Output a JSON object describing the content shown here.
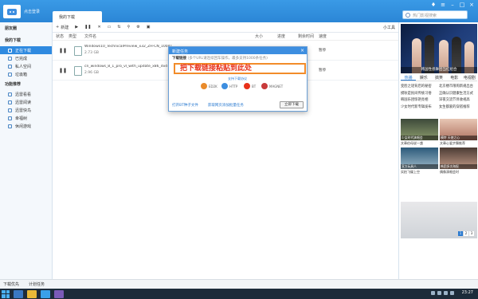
{
  "titlebar": {
    "login_label": "点击登录",
    "tab_label": "我的下载",
    "search_placeholder": "热门影视搜索"
  },
  "sidebar": {
    "section1": "朋友圈",
    "section2": "我的下载",
    "items1": [
      "正在下载",
      "已完成",
      "私人空间",
      "垃圾箱"
    ],
    "section3": "功能推荐",
    "items2": [
      "迅雷看看",
      "迅雷阅读",
      "迅雷快鸟",
      "幸福树",
      "休闲游戏"
    ]
  },
  "toolbar": {
    "new_label": "新建",
    "small_tool": "小工具"
  },
  "columns": [
    "状态",
    "类型",
    "文件名",
    "大小",
    "进度",
    "剩余时间",
    "速度"
  ],
  "tasks": [
    {
      "name": "Windows10_TechnicalPreview_x32_ZH-CN_10041",
      "size": "2.73 GB",
      "state": "暂停"
    },
    {
      "name": "cn_windows_8_1_pro_vl_with_update_x86_dvd",
      "size": "2.96 GB",
      "state": "暂停"
    }
  ],
  "dialog": {
    "title": "新建任务",
    "subtitle_bold": "下载链接",
    "subtitle_hint": "(多个URL请连续回车操作，最多支持1000条任务)",
    "paste_text": "把下载链接粘贴到此处",
    "protocols_link": "支持下载协议",
    "protocols": [
      "ED2K",
      "HTTP",
      "BT",
      "MAGNET"
    ],
    "open_torrent": "打开BT种子文件",
    "batch_link": "获取网页添加批量任务",
    "download_button": "立即下载"
  },
  "right_panel": {
    "banner_caption": "韩国性感舞团当红组合",
    "tabs": [
      "热播",
      "娱乐",
      "搞笑",
      "电影",
      "电视剧"
    ],
    "news": [
      [
        "变脸之谜背后的秘密",
        "北京楼市限购新规出台"
      ],
      [
        "摸秋是民间传统习俗",
        "正确认识健康生活方式"
      ],
      [
        "韩国乐团惊艳亮相",
        "深夜交流节目收视高"
      ],
      [
        "少女时代新专辑发布",
        "女生都爱的穿搭推荐"
      ]
    ],
    "thumbs": [
      {
        "caption": "少女时代演唱会",
        "title": "文章伯母说一盏"
      },
      {
        "caption": "模特 天使之心",
        "title": "文章心爱步舞推荐"
      },
      {
        "caption": "宣方玩具人",
        "title": "实拍飞碟上空"
      },
      {
        "caption": "韩团多次海报",
        "title": "偶像演唱会时"
      }
    ],
    "pager": [
      "1",
      "2",
      "3"
    ]
  },
  "statusbar": {
    "download_first": "下载优先",
    "scheduled": "计划任务"
  },
  "taskbar": {
    "clock": "23:27"
  },
  "colors": {
    "accent": "#2f8ae0",
    "paste_text": "#e8311a",
    "paste_border": "#f28c2a"
  }
}
